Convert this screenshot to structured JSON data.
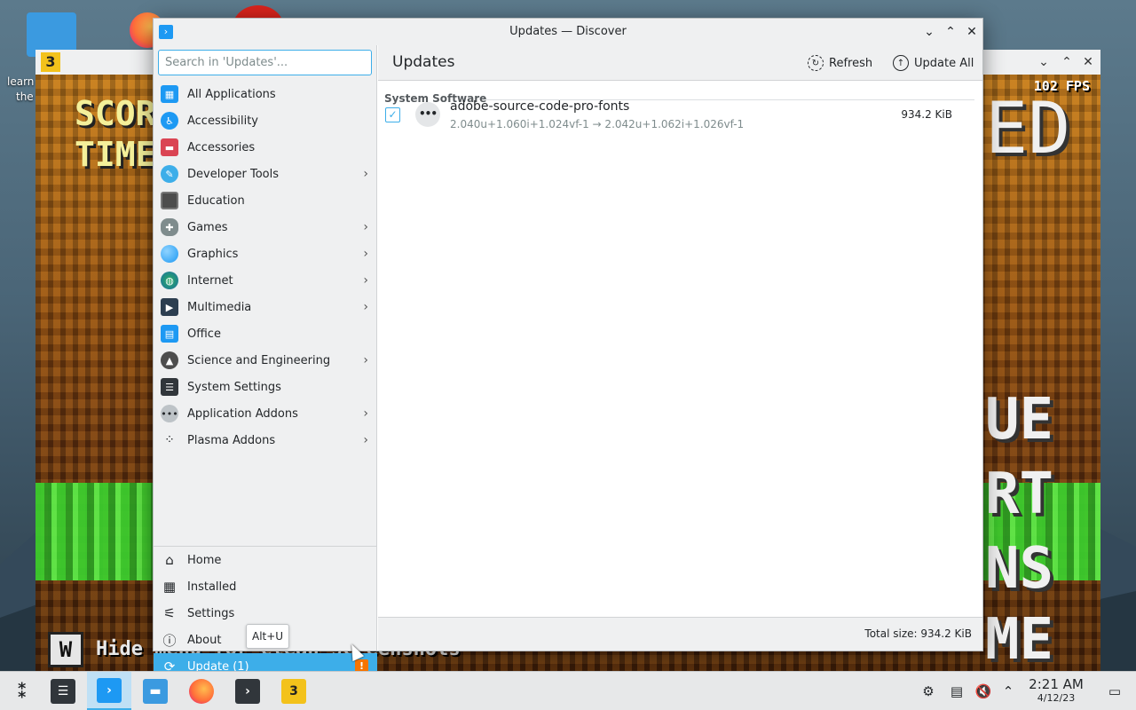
{
  "desktop": {
    "icon_label_line1": "learn",
    "icon_label_line2": "the"
  },
  "game_window": {
    "fps": "102 FPS",
    "left_text_1": "SCOR",
    "left_text_2": "TIME",
    "right_text_1": "UE",
    "right_text_2": "RT",
    "right_text_3": "NS",
    "right_text_4": "ME",
    "right_text_top": "ED",
    "hint_key": "W",
    "hint_text": "Hide menu for clean screenshots",
    "logo": "3"
  },
  "window": {
    "title": "Updates — Discover"
  },
  "search": {
    "placeholder": "Search in 'Updates'..."
  },
  "categories": [
    {
      "label": "All Applications",
      "icon": "grid-icon",
      "color": "#1d99f3",
      "chevron": false
    },
    {
      "label": "Accessibility",
      "icon": "accessibility-icon",
      "color": "#1d99f3",
      "chevron": false
    },
    {
      "label": "Accessories",
      "icon": "toolbox-icon",
      "color": "#da4453",
      "chevron": false
    },
    {
      "label": "Developer Tools",
      "icon": "hammer-icon",
      "color": "#3daee9",
      "chevron": true
    },
    {
      "label": "Education",
      "icon": "chalkboard-icon",
      "color": "#4d4d4d",
      "chevron": false
    },
    {
      "label": "Games",
      "icon": "gamepad-icon",
      "color": "#7f8c8d",
      "chevron": true
    },
    {
      "label": "Graphics",
      "icon": "graphics-icon",
      "color": "#1d99f3",
      "chevron": true
    },
    {
      "label": "Internet",
      "icon": "globe-icon",
      "color": "#27ae60",
      "chevron": true
    },
    {
      "label": "Multimedia",
      "icon": "monitor-icon",
      "color": "#2c3e50",
      "chevron": true
    },
    {
      "label": "Office",
      "icon": "document-icon",
      "color": "#1d99f3",
      "chevron": false
    },
    {
      "label": "Science and Engineering",
      "icon": "flask-icon",
      "color": "#4d4d4d",
      "chevron": true
    },
    {
      "label": "System Settings",
      "icon": "settings-panel-icon",
      "color": "#31363b",
      "chevron": false
    },
    {
      "label": "Application Addons",
      "icon": "dots-icon",
      "color": "#bdc3c7",
      "chevron": true
    },
    {
      "label": "Plasma Addons",
      "icon": "plasma-icon",
      "color": "#eff0f1",
      "chevron": true
    }
  ],
  "bottom_nav": {
    "home": "Home",
    "installed": "Installed",
    "settings": "Settings",
    "about": "About",
    "update": "Update (1)",
    "update_badge": "!"
  },
  "tooltip": "Alt+U",
  "main": {
    "page_title": "Updates",
    "refresh_label": "Refresh",
    "update_all_label": "Update All",
    "section_title": "System Software",
    "updates": [
      {
        "name": "adobe-source-code-pro-fonts",
        "version": "2.040u+1.060i+1.024vf-1 → 2.042u+1.062i+1.026vf-1",
        "size": "934.2 KiB",
        "checked": true
      }
    ],
    "total_size": "Total size: 934.2 KiB"
  },
  "taskbar": {
    "clock_time": "2:21 AM",
    "clock_date": "4/12/23",
    "active_app": "discover"
  },
  "colors": {
    "accent": "#3daee9",
    "badge": "#f67400",
    "window_bg": "#eff0f1"
  }
}
